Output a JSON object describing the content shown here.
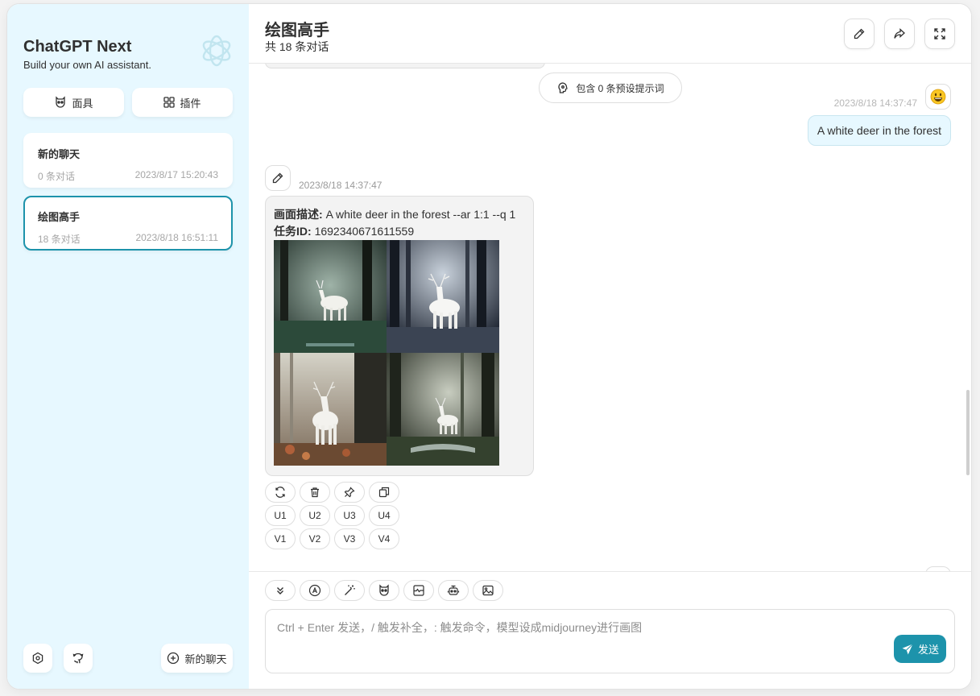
{
  "sidebar": {
    "brand_title": "ChatGPT Next",
    "brand_subtitle": "Build your own AI assistant.",
    "mask_label": "面具",
    "plugin_label": "插件",
    "chats": [
      {
        "title": "新的聊天",
        "count": "0 条对话",
        "time": "2023/8/17 15:20:43"
      },
      {
        "title": "绘图高手",
        "count": "18 条对话",
        "time": "2023/8/18 16:51:11"
      }
    ],
    "new_chat_label": "新的聊天"
  },
  "header": {
    "title": "绘图高手",
    "subtitle": "共 18 条对话"
  },
  "chat": {
    "preset_label": "包含 0 条预设提示词",
    "user_time": "2023/8/18 14:37:47",
    "user_message": "A white deer in the forest",
    "bot_time": "2023/8/18 14:37:47",
    "desc_label": "画面描述:",
    "desc_value": "A white deer in the forest --ar 1:1 --q 1",
    "task_label": "任务ID:",
    "task_value": "1692340671611559",
    "upscale_buttons": [
      "U1",
      "U2",
      "U3",
      "U4"
    ],
    "variation_buttons": [
      "V1",
      "V2",
      "V3",
      "V4"
    ]
  },
  "input": {
    "placeholder": "Ctrl + Enter 发送，/ 触发补全，: 触发命令，模型设成midjourney进行画图",
    "send_label": "发送"
  },
  "colors": {
    "accent": "#1d93ab",
    "sidebar_bg": "#e7f8ff",
    "user_bubble": "#e7f8ff"
  }
}
